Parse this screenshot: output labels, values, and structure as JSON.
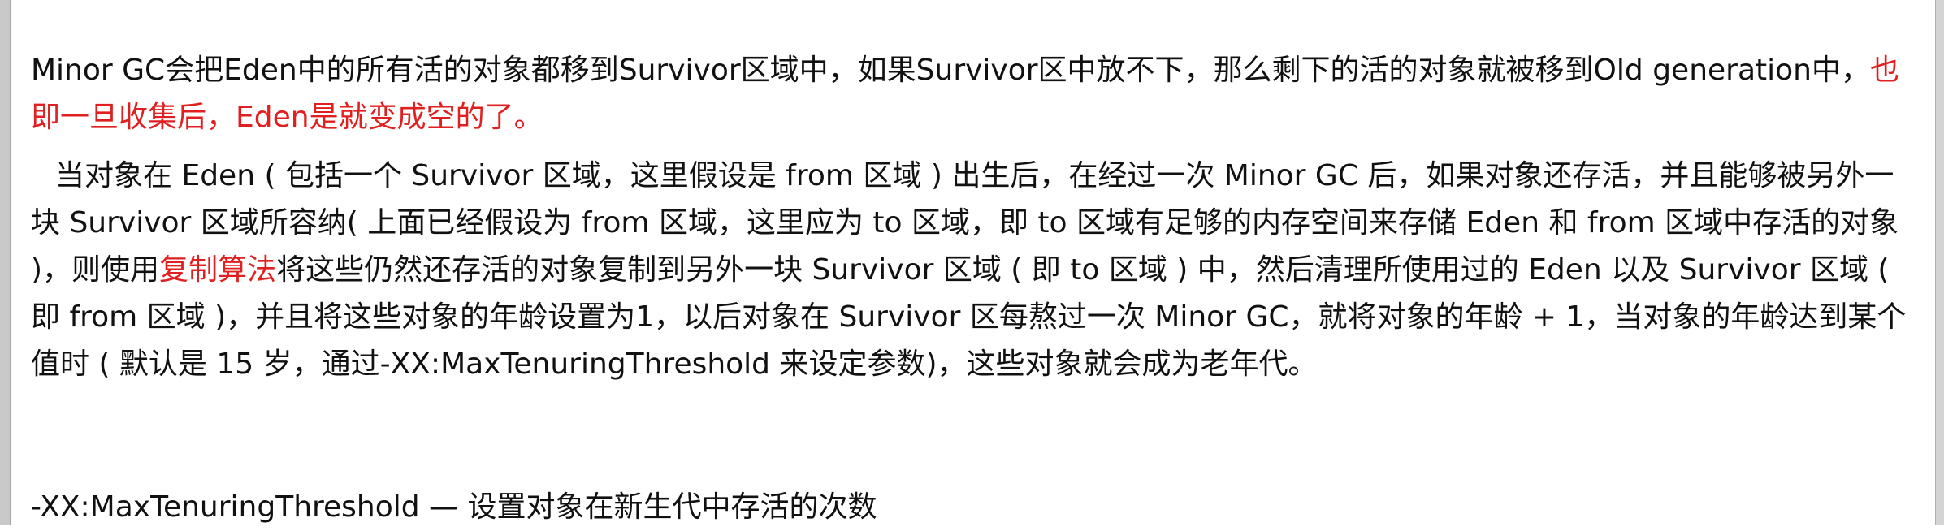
{
  "paragraph1": {
    "part1": "Minor GC会把Eden中的所有活的对象都移到Survivor区域中，如果Survivor区中放不下，那么剩下的活的对象就被移到Old generation中，",
    "highlight": "也即一旦收集后，Eden是就变成空的了。"
  },
  "paragraph2": {
    "part1": "当对象在 Eden ( 包括一个 Survivor 区域，这里假设是 from 区域 ) 出生后，在经过一次 Minor GC 后，如果对象还存活，并且能够被另外一块 Survivor 区域所容纳( 上面已经假设为 from 区域，这里应为 to 区域，即 to 区域有足够的内存空间来存储 Eden 和 from 区域中存活的对象 )，则使用",
    "highlight": "复制算法",
    "part2": "将这些仍然还存活的对象复制到另外一块 Survivor 区域 ( 即 to 区域 ) 中，然后清理所使用过的 Eden 以及 Survivor 区域 ( 即 from 区域 )，并且将这些对象的年龄设置为1，以后对象在 Survivor 区每熬过一次 Minor GC，就将对象的年龄 + 1，当对象的年龄达到某个值时 ( 默认是 15 岁，通过-XX:MaxTenuringThreshold 来设定参数)，这些对象就会成为老年代。"
  },
  "paragraph3": {
    "text": "-XX:MaxTenuringThreshold — 设置对象在新生代中存活的次数"
  },
  "colors": {
    "highlight": "#e02020",
    "text": "#111111"
  }
}
